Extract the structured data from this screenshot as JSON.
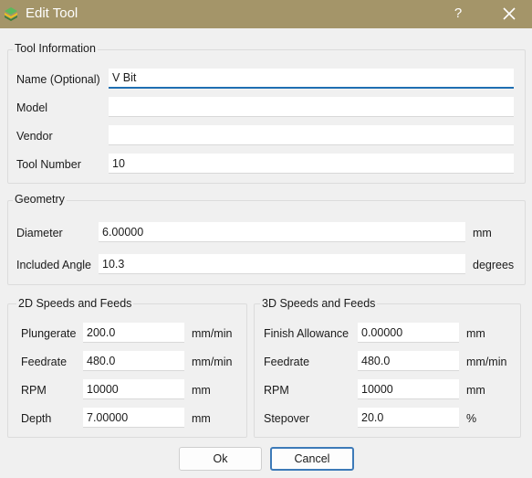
{
  "window": {
    "title": "Edit Tool",
    "help_label": "?",
    "icons": {
      "app": "app-logo-icon",
      "close": "close-icon"
    }
  },
  "tool_info": {
    "title": "Tool Information",
    "name_label": "Name (Optional)",
    "name_value": "V Bit",
    "model_label": "Model",
    "model_value": "",
    "vendor_label": "Vendor",
    "vendor_value": "",
    "tool_number_label": "Tool Number",
    "tool_number_value": "10"
  },
  "geometry": {
    "title": "Geometry",
    "diameter_label": "Diameter",
    "diameter_value": "6.00000",
    "diameter_unit": "mm",
    "angle_label": "Included Angle",
    "angle_value": "10.3",
    "angle_unit": "degrees"
  },
  "speeds_2d": {
    "title": "2D Speeds and Feeds",
    "plungerate_label": "Plungerate",
    "plungerate_value": "200.0",
    "plungerate_unit": "mm/min",
    "feedrate_label": "Feedrate",
    "feedrate_value": "480.0",
    "feedrate_unit": "mm/min",
    "rpm_label": "RPM",
    "rpm_value": "10000",
    "rpm_unit": "mm",
    "depth_label": "Depth",
    "depth_value": "7.00000",
    "depth_unit": "mm"
  },
  "speeds_3d": {
    "title": "3D Speeds and Feeds",
    "finish_label": "Finish Allowance",
    "finish_value": "0.00000",
    "finish_unit": "mm",
    "feedrate_label": "Feedrate",
    "feedrate_value": "480.0",
    "feedrate_unit": "mm/min",
    "rpm_label": "RPM",
    "rpm_value": "10000",
    "rpm_unit": "mm",
    "stepover_label": "Stepover",
    "stepover_value": "20.0",
    "stepover_unit": "%"
  },
  "buttons": {
    "ok": "Ok",
    "cancel": "Cancel"
  },
  "colors": {
    "titlebar": "#a49569",
    "focus": "#1f6fb2",
    "default_button": "#3d7ab8"
  }
}
